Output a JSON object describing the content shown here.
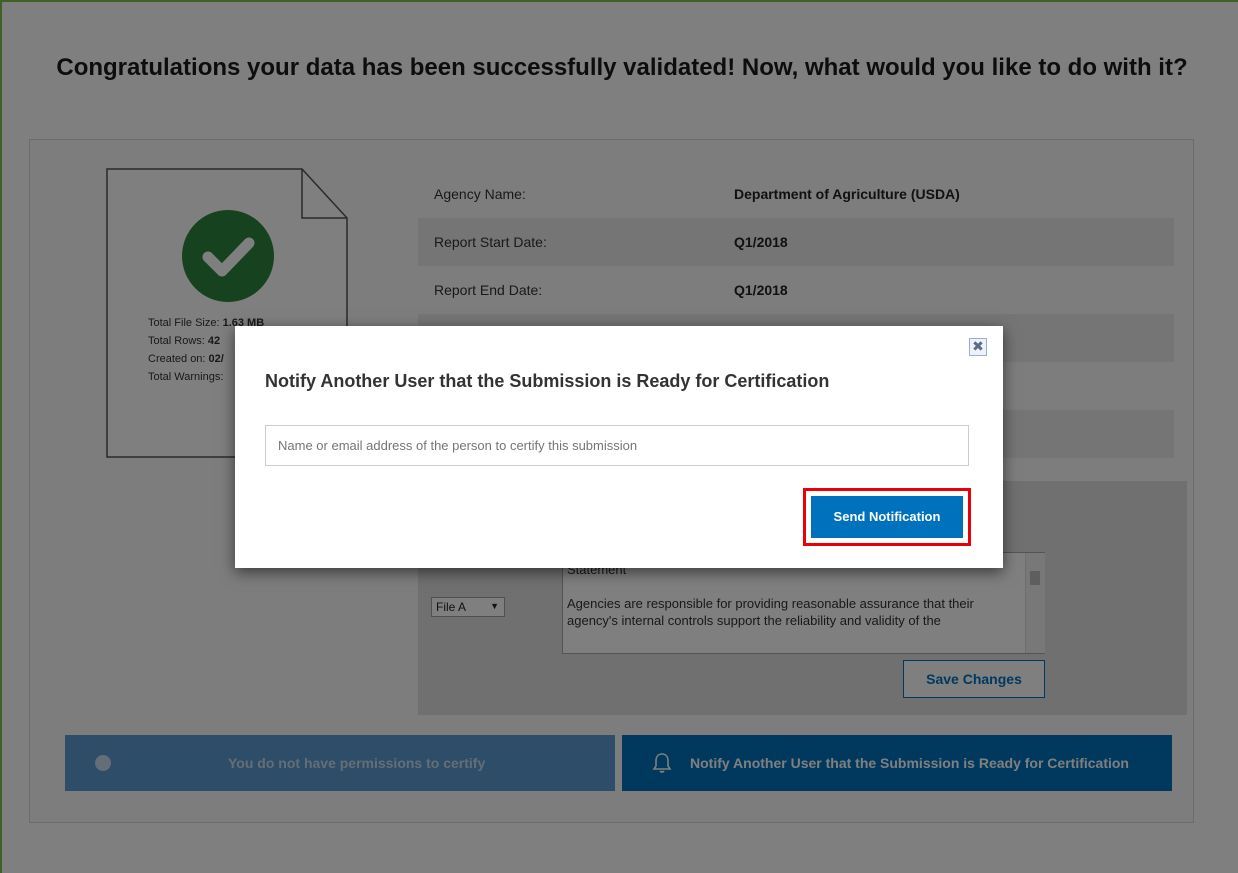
{
  "page": {
    "title": "Congratulations your data has been successfully validated! Now, what would you like to do with it?"
  },
  "file_summary": {
    "size_label": "Total File Size: ",
    "size_value": "1.63 MB",
    "rows_label": "Total Rows: ",
    "rows_value": "42",
    "created_label": "Created on: ",
    "created_value": "02/",
    "warnings_label": "Total Warnings:",
    "status_color": "#2e8540"
  },
  "details": [
    {
      "label": "Agency Name:",
      "value": "Department of Agriculture (USDA)"
    },
    {
      "label": "Report Start Date:",
      "value": "Q1/2018"
    },
    {
      "label": "Report End Date:",
      "value": "Q1/2018"
    }
  ],
  "comments": {
    "file_select_value": "File A",
    "text_line1": "Statement",
    "text_line2": "Agencies are responsible for providing reasonable assurance that their agency's internal controls support the reliability and validity of the",
    "save_label": "Save Changes"
  },
  "actions": {
    "no_permission_label": "You do not have permissions to certify",
    "notify_label": "Notify Another User that the Submission is Ready for Certification"
  },
  "modal": {
    "title": "Notify Another User that the Submission is Ready for Certification",
    "input_placeholder": "Name or email address of the person to certify this submission",
    "send_label": "Send Notification",
    "close_glyph": "✖"
  },
  "colors": {
    "primary": "#0071bc",
    "success": "#2e8540",
    "highlight": "#e8000b"
  }
}
